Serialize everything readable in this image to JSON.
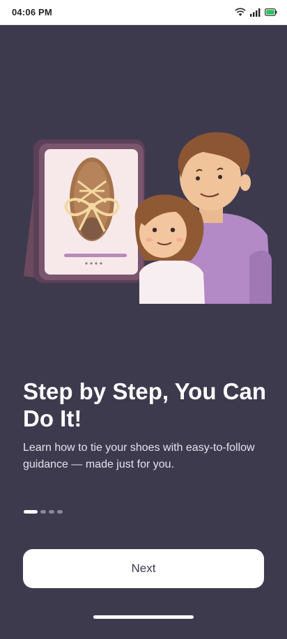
{
  "status_bar": {
    "time": "04:06 PM",
    "icons": [
      "wifi-icon",
      "signal-icon",
      "battery-icon"
    ],
    "battery_color": "#22c55e"
  },
  "onboarding": {
    "title": "Step by Step, You Can Do It!",
    "description": "Learn how to tie your shoes with easy-to-follow guidance — made just for you.",
    "page_indicator": {
      "total": 4,
      "active_index": 0
    },
    "next_label": "Next"
  },
  "colors": {
    "background": "#3e3a4e",
    "button_bg": "#ffffff",
    "button_text": "#3e3a4e"
  }
}
